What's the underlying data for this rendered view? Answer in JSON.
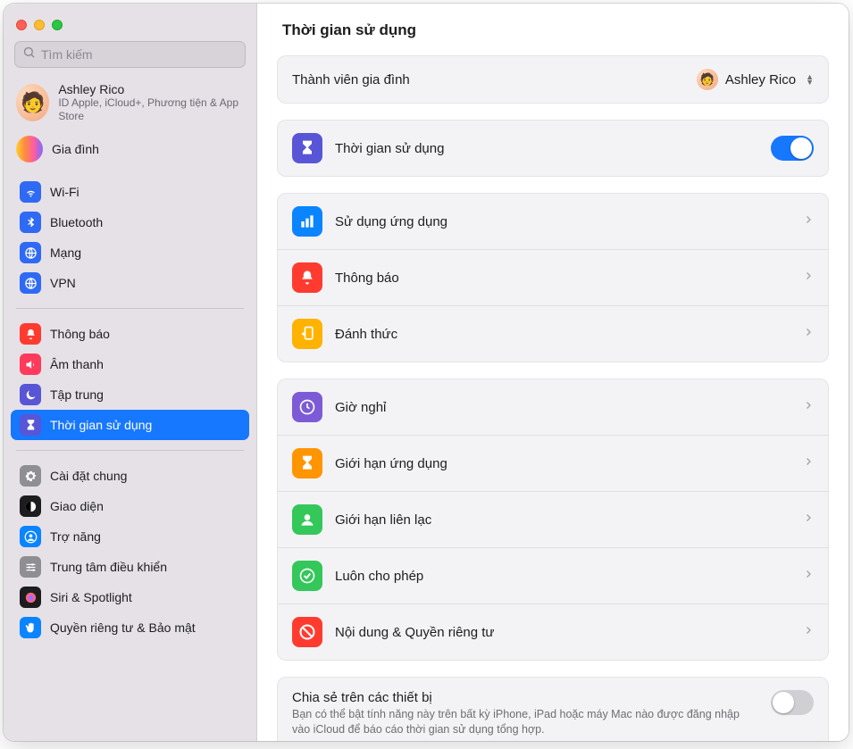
{
  "header": {
    "title": "Thời gian sử dụng"
  },
  "search": {
    "placeholder": "Tìm kiếm"
  },
  "account": {
    "name": "Ashley Rico",
    "sub": "ID Apple, iCloud+, Phương tiện & App Store"
  },
  "family": {
    "label": "Gia đình"
  },
  "sidebar": {
    "groups": [
      [
        {
          "key": "wifi",
          "label": "Wi-Fi",
          "icon": "wifi",
          "bg": "#2f6af5"
        },
        {
          "key": "bluetooth",
          "label": "Bluetooth",
          "icon": "bluetooth",
          "bg": "#2f6af5"
        },
        {
          "key": "network",
          "label": "Mạng",
          "icon": "globe",
          "bg": "#2f6af5"
        },
        {
          "key": "vpn",
          "label": "VPN",
          "icon": "globe",
          "bg": "#2f6af5"
        }
      ],
      [
        {
          "key": "notifications",
          "label": "Thông báo",
          "icon": "bell",
          "bg": "#ff3b30"
        },
        {
          "key": "sound",
          "label": "Âm thanh",
          "icon": "speaker",
          "bg": "#ff3b5c"
        },
        {
          "key": "focus",
          "label": "Tập trung",
          "icon": "moon",
          "bg": "#5856d6"
        },
        {
          "key": "screentime",
          "label": "Thời gian sử dụng",
          "icon": "hourglass",
          "bg": "#5856d6",
          "selected": true
        }
      ],
      [
        {
          "key": "general",
          "label": "Cài đặt chung",
          "icon": "gear",
          "bg": "#8e8e93"
        },
        {
          "key": "appearance",
          "label": "Giao diện",
          "icon": "contrast",
          "bg": "#1d1d1f"
        },
        {
          "key": "accessibility",
          "label": "Trợ năng",
          "icon": "person",
          "bg": "#0a84ff"
        },
        {
          "key": "controlcenter",
          "label": "Trung tâm điều khiển",
          "icon": "sliders",
          "bg": "#8e8e93"
        },
        {
          "key": "siri",
          "label": "Siri & Spotlight",
          "icon": "siri",
          "bg": "#1d1d1f"
        },
        {
          "key": "privacy",
          "label": "Quyền riêng tư & Bảo mật",
          "icon": "hand",
          "bg": "#0a84ff"
        }
      ]
    ]
  },
  "member": {
    "label": "Thành viên gia đình",
    "value": "Ashley Rico"
  },
  "main_toggle": {
    "label": "Thời gian sử dụng",
    "on": true
  },
  "usage_rows": [
    {
      "key": "app-usage",
      "label": "Sử dụng ứng dụng",
      "icon": "bars",
      "bg": "#0a84ff"
    },
    {
      "key": "notif",
      "label": "Thông báo",
      "icon": "bell",
      "bg": "#ff3b30"
    },
    {
      "key": "pickups",
      "label": "Đánh thức",
      "icon": "pickup",
      "bg": "#ffb300"
    }
  ],
  "limit_rows": [
    {
      "key": "downtime",
      "label": "Giờ nghỉ",
      "icon": "clock",
      "bg": "#7d5bd6"
    },
    {
      "key": "app-limits",
      "label": "Giới hạn ứng dụng",
      "icon": "hourglass",
      "bg": "#ff9500"
    },
    {
      "key": "comm-limits",
      "label": "Giới hạn liên lạc",
      "icon": "contact",
      "bg": "#34c759"
    },
    {
      "key": "always-allow",
      "label": "Luôn cho phép",
      "icon": "check",
      "bg": "#34c759"
    },
    {
      "key": "content",
      "label": "Nội dung & Quyền riêng tư",
      "icon": "nosign",
      "bg": "#ff3b30"
    }
  ],
  "share": {
    "title": "Chia sẻ trên các thiết bị",
    "desc": "Bạn có thể bật tính năng này trên bất kỳ iPhone, iPad hoặc máy Mac nào được đăng nhập vào iCloud để báo cáo thời gian sử dụng tổng hợp.",
    "on": false
  },
  "colors": {
    "accent": "#1677ff"
  }
}
